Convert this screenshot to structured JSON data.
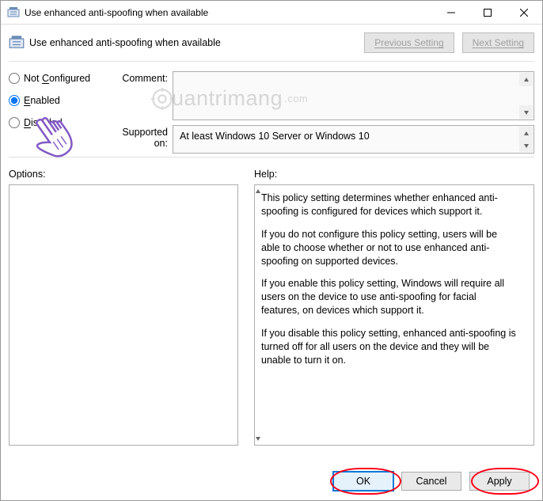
{
  "window": {
    "title": "Use enhanced anti-spoofing when available"
  },
  "header": {
    "title": "Use enhanced anti-spoofing when available"
  },
  "nav": {
    "previous": "Previous Setting",
    "next": "Next Setting"
  },
  "radios": {
    "notConfigured_pre": "Not ",
    "notConfigured_u": "C",
    "notConfigured_post": "onfigured",
    "enabled_u": "E",
    "enabled_post": "nabled",
    "disabled_u": "D",
    "disabled_post": "isabled",
    "selected": "enabled"
  },
  "labels": {
    "comment": "Comment:",
    "supported": "Supported on:",
    "options": "Options:",
    "help": "Help:"
  },
  "supported_text": "At least Windows 10 Server or Windows 10",
  "help": {
    "p1": "This policy setting determines whether enhanced anti-spoofing is configured for devices which support it.",
    "p2": "If you do not configure this policy setting, users will be able to choose whether or not to use enhanced anti-spoofing on supported devices.",
    "p3": "If you enable this policy setting, Windows will require all users on the device to use anti-spoofing for facial features, on devices which support it.",
    "p4": "If you disable this policy setting, enhanced anti-spoofing is turned off for all users on the device and they will be unable to turn it on."
  },
  "buttons": {
    "ok": "OK",
    "cancel": "Cancel",
    "apply": "Apply"
  },
  "watermark": "uantrimang"
}
